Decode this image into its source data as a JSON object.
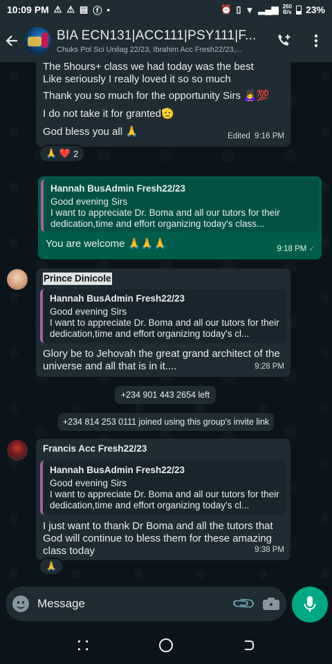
{
  "status_bar": {
    "time": "10:09 PM",
    "net_speed_value": "260",
    "net_speed_unit": "B/s",
    "battery": "23%"
  },
  "header": {
    "title": "BIA ECN131|ACC111|PSY111|F...",
    "subtitle": "Chuks Pol Sci Unilag 22/23, Ibrahim Acc Fresh22/23,..."
  },
  "messages": [
    {
      "type": "incoming-cont",
      "lines": [
        "The 5hours+ class we had today was the best",
        "Like seriously I really loved it so so much",
        "Thank you so much for the opportunity Sirs 🙇‍♀️💯",
        "I do not take it for granted🫡",
        "God bless you all 🙏"
      ],
      "time": "Edited  9:16 PM",
      "reactions": "🙏 ❤️",
      "reaction_count": "2"
    },
    {
      "type": "outgoing",
      "quote_author": "Hannah BusAdmin Fresh22/23",
      "quote_text": "Good evening Sirs\nI want to appreciate Dr. Boma and all our tutors for their dedication,time and effort  organizing today's class...",
      "text": "You are welcome 🙏🙏🙏",
      "time": "9:18 PM"
    },
    {
      "type": "incoming",
      "sender": "Prince Dinicole",
      "quote_author": "Hannah BusAdmin Fresh22/23",
      "quote_text": "Good evening Sirs\nI want to appreciate Dr. Boma and all our tutors for their dedication,time and effort  organizing today's cl...",
      "text": "Glory be to Jehovah the great grand architect of the universe and all that is in it....",
      "time": "9:28 PM"
    },
    {
      "type": "system",
      "text": "+234 901 443 2654 left"
    },
    {
      "type": "system",
      "text": "+234 814 253 0111 joined using this group's invite link"
    },
    {
      "type": "incoming",
      "sender": "Francis Acc Fresh22/23",
      "quote_author": "Hannah BusAdmin Fresh22/23",
      "quote_text": "Good evening Sirs\nI want to appreciate Dr. Boma and all our tutors for their dedication,time and effort  organizing today's cl...",
      "text": "I just want to thank Dr Boma and all the tutors that God will continue to bless them for these amazing class today",
      "time": "9:38 PM",
      "reactions": "🙏"
    }
  ],
  "composer": {
    "placeholder": "Message"
  },
  "colors": {
    "background": "#0b141a",
    "incoming_bubble": "#1f2c34",
    "outgoing_bubble": "#005c4b",
    "accent": "#00a884",
    "quote_bar": "#a5629b"
  }
}
